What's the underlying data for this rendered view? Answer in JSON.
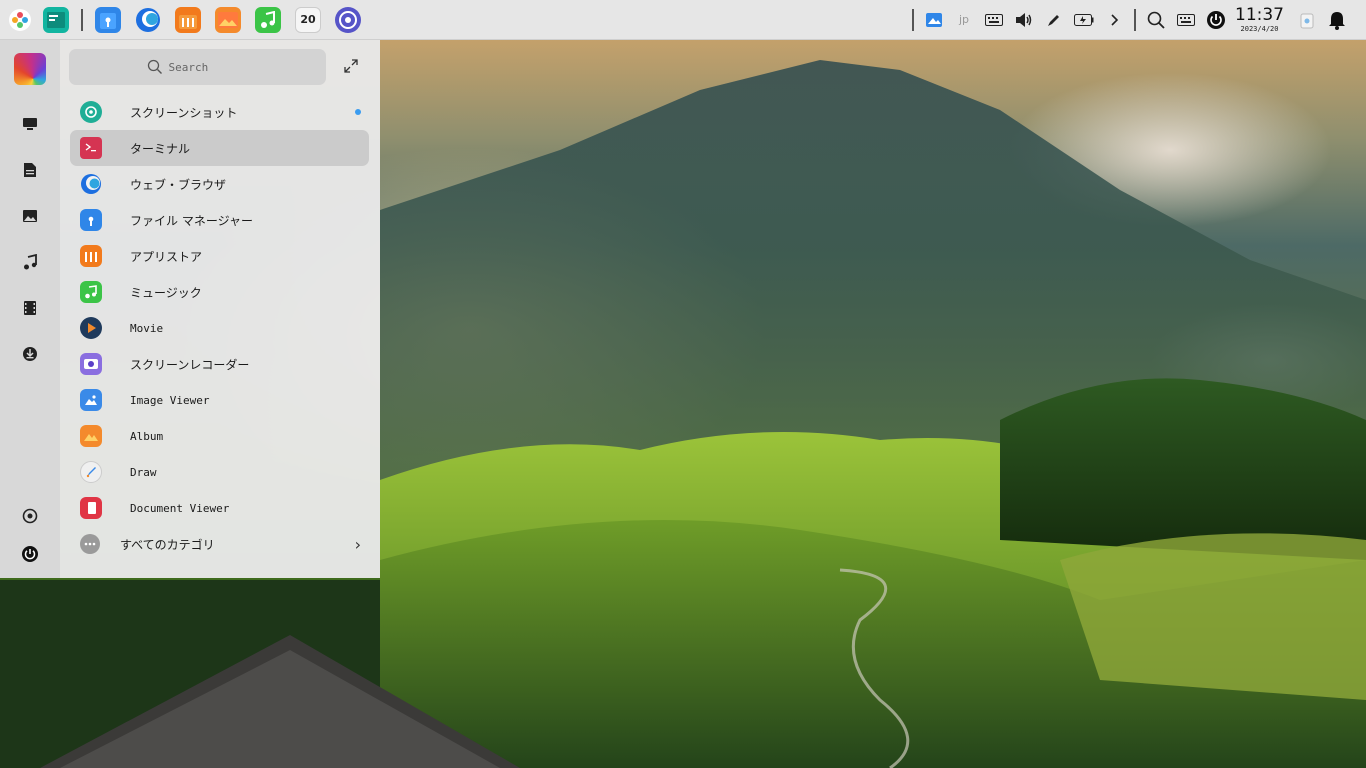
{
  "taskbar": {
    "apps": [
      {
        "name": "terminal-board",
        "color": "#12b5a0"
      },
      {
        "name": "file-manager",
        "color": "#2f86e8"
      },
      {
        "name": "browser",
        "color": "#ffffff"
      },
      {
        "name": "app-store",
        "color": "#f27a1c"
      },
      {
        "name": "album",
        "color": "#f48a2c"
      },
      {
        "name": "music",
        "color": "#3bc447"
      },
      {
        "name": "calendar",
        "color": "#f5f5f5",
        "date_label": "20"
      },
      {
        "name": "settings",
        "color": "#5654c8"
      }
    ]
  },
  "tray": {
    "input_method": "jp",
    "clock_time": "11:37",
    "clock_date": "2023/4/20"
  },
  "search": {
    "placeholder": "Search"
  },
  "launcher": {
    "apps": [
      {
        "label": "スクリーンショット",
        "icon": "screenshot-icon",
        "color": "#1fae96",
        "new": true
      },
      {
        "label": "ターミナル",
        "icon": "terminal-icon",
        "color": "#d53452",
        "selected": true
      },
      {
        "label": "ウェブ・ブラウザ",
        "icon": "browser-icon",
        "color": "#2a73e0"
      },
      {
        "label": "ファイル マネージャー",
        "icon": "folder-icon",
        "color": "#2f86e8"
      },
      {
        "label": "アプリストア",
        "icon": "store-icon",
        "color": "#f27a1c"
      },
      {
        "label": "ミュージック",
        "icon": "music-icon",
        "color": "#3bc447"
      },
      {
        "label": "Movie",
        "icon": "movie-icon",
        "color": "#1f3a5c"
      },
      {
        "label": "スクリーンレコーダー",
        "icon": "recorder-icon",
        "color": "#8a6ee0"
      },
      {
        "label": "Image Viewer",
        "icon": "image-viewer-icon",
        "color": "#3a8ae8"
      },
      {
        "label": "Album",
        "icon": "album-icon",
        "color": "#f48a2c"
      },
      {
        "label": "Draw",
        "icon": "draw-icon",
        "color": "#f0f0f0"
      },
      {
        "label": "Document Viewer",
        "icon": "document-viewer-icon",
        "color": "#e03545"
      }
    ],
    "categories_label": "すべてのカテゴリ"
  }
}
